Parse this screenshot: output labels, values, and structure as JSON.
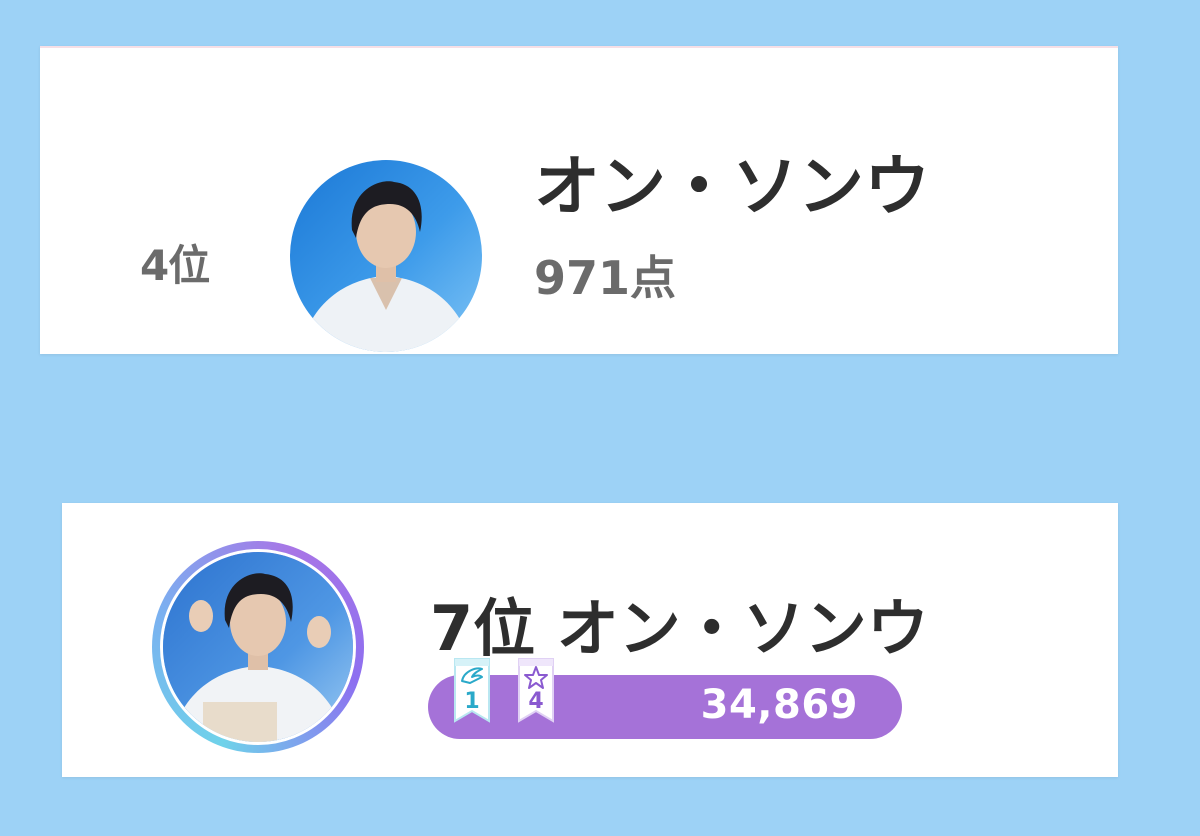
{
  "entries": [
    {
      "rank_label": "4位",
      "name": "オン・ソンウ",
      "score_label": "971点"
    },
    {
      "rank_name_label": "7位 オン・ソンウ",
      "badges": [
        {
          "icon": "wing-icon",
          "value": "1",
          "color": "#2aa9c9"
        },
        {
          "icon": "star-icon",
          "value": "4",
          "color": "#8a5ad0"
        }
      ],
      "votes": "34,869",
      "bar_color": "#a572d8"
    }
  ]
}
